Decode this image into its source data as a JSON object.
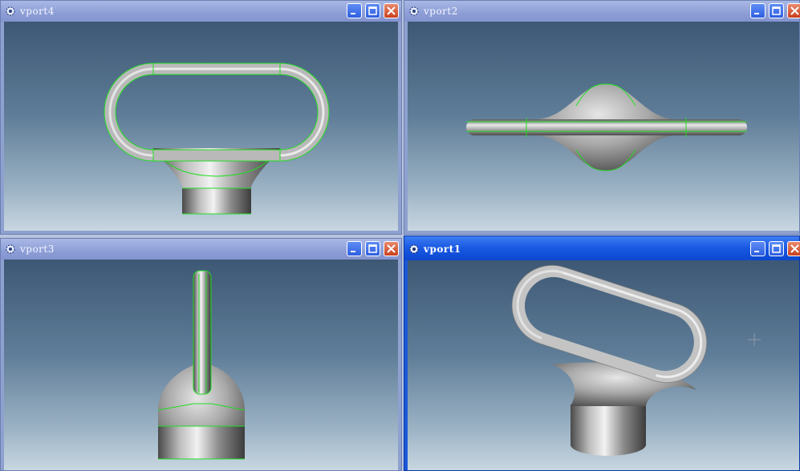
{
  "viewports": [
    {
      "id": "vp4",
      "title": "vport4"
    },
    {
      "id": "vp2",
      "title": "vport2"
    },
    {
      "id": "vp3",
      "title": "vport3"
    },
    {
      "id": "vp1",
      "title": "vport1"
    }
  ],
  "window_buttons": {
    "minimize": "minimize-icon",
    "maximize": "maximize-icon",
    "close": "close-icon"
  },
  "colors": {
    "active_titlebar": "#1858e2",
    "inactive_titlebar": "#8d9ed6",
    "edge_highlight": "#22dd22",
    "background_top": "#3d5874",
    "background_bottom": "#c8d7e1"
  }
}
